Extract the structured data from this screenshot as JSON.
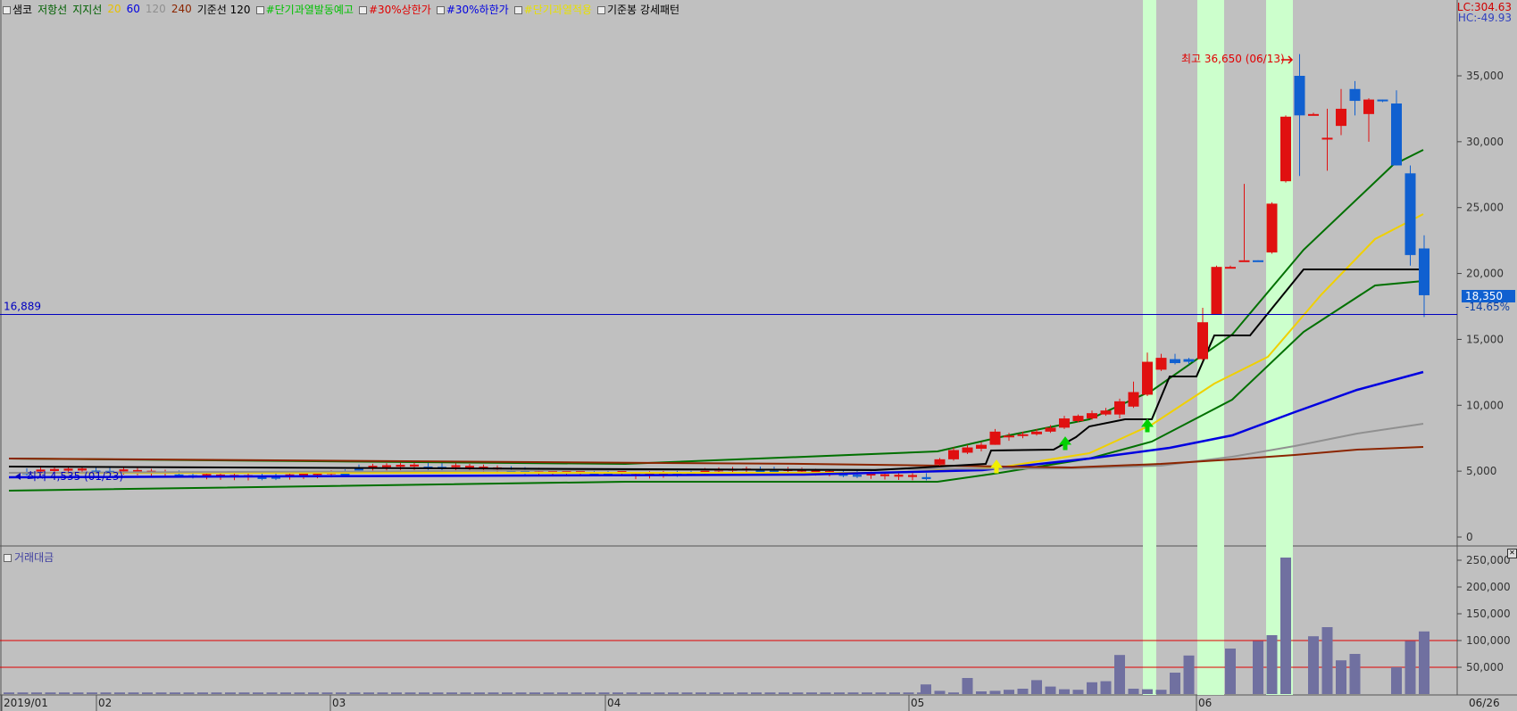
{
  "header": {
    "items": [
      {
        "label": "샘코",
        "color": "#000000",
        "box": true
      },
      {
        "label": "저항선",
        "color": "#006000",
        "box": false
      },
      {
        "label": "지지선",
        "color": "#006000",
        "box": false
      },
      {
        "label": "20",
        "color": "#e8c000",
        "box": false
      },
      {
        "label": "60",
        "color": "#0000e0",
        "box": false
      },
      {
        "label": "120",
        "color": "#909090",
        "box": false
      },
      {
        "label": "240",
        "color": "#8b2500",
        "box": false
      },
      {
        "label": "기준선 120",
        "color": "#000000",
        "box": false
      },
      {
        "label": "#단기과열발동예고",
        "color": "#00c000",
        "box": true
      },
      {
        "label": "#30%상한가",
        "color": "#e00000",
        "box": true
      },
      {
        "label": "#30%하한가",
        "color": "#0000e0",
        "box": true
      },
      {
        "label": "#단기과열적용",
        "color": "#e8e000",
        "box": true
      },
      {
        "label": "기준봉 강세패턴",
        "color": "#000000",
        "box": true
      }
    ],
    "lc_label": "LC:304.63",
    "hc_label": "HC:-49.93"
  },
  "volume_panel": {
    "title": "거래대금"
  },
  "colors": {
    "up": "#e01010",
    "down": "#1060d0",
    "highlight": "#ccffcc",
    "background": "#c0c0c0",
    "current_line": "#0000c0"
  },
  "chart_data": {
    "type": "candlestick",
    "price_axis": {
      "ticks": [
        0,
        5000,
        10000,
        15000,
        20000,
        25000,
        30000,
        35000
      ],
      "ylim": [
        0,
        40500
      ]
    },
    "volume_axis": {
      "ticks": [
        50000,
        100000,
        150000,
        200000,
        250000
      ],
      "ylim": [
        0,
        270000
      ],
      "reference_lines": [
        50000,
        100000
      ]
    },
    "x_labels": [
      "2019/01",
      "02",
      "03",
      "04",
      "05",
      "06",
      "06/26"
    ],
    "current_price_line": {
      "value": 16889,
      "label": "16,889"
    },
    "last_price": {
      "label": "18,350",
      "change": "-14.65%"
    },
    "annotations": [
      {
        "text": "최고 36,650 (06/13)",
        "value": 36650
      },
      {
        "text": "최저 4,535 (01/23)",
        "value": 4535
      }
    ],
    "highlight_days": [
      -3,
      [
        -2,
        -1
      ],
      [
        1,
        2
      ]
    ],
    "candles_recent": [
      {
        "o": 5500,
        "h": 6000,
        "l": 5400,
        "c": 5900
      },
      {
        "o": 5900,
        "h": 6800,
        "l": 5800,
        "c": 6600
      },
      {
        "o": 6400,
        "h": 7000,
        "l": 6300,
        "c": 6800
      },
      {
        "o": 6700,
        "h": 7200,
        "l": 6500,
        "c": 7000
      },
      {
        "o": 7000,
        "h": 8200,
        "l": 7000,
        "c": 8000
      },
      {
        "o": 7600,
        "h": 7900,
        "l": 7300,
        "c": 7700
      },
      {
        "o": 7700,
        "h": 8000,
        "l": 7500,
        "c": 7800
      },
      {
        "o": 7800,
        "h": 8200,
        "l": 7700,
        "c": 8000
      },
      {
        "o": 8000,
        "h": 8500,
        "l": 7900,
        "c": 8300
      },
      {
        "o": 8300,
        "h": 9200,
        "l": 8200,
        "c": 9000
      },
      {
        "o": 8800,
        "h": 9300,
        "l": 8700,
        "c": 9200
      },
      {
        "o": 9000,
        "h": 9600,
        "l": 8900,
        "c": 9400
      },
      {
        "o": 9300,
        "h": 9800,
        "l": 9200,
        "c": 9600
      },
      {
        "o": 9300,
        "h": 10500,
        "l": 9000,
        "c": 10300
      },
      {
        "o": 9900,
        "h": 11800,
        "l": 9800,
        "c": 11000
      },
      {
        "o": 10800,
        "h": 14000,
        "l": 10700,
        "c": 13300
      },
      {
        "o": 12700,
        "h": 13900,
        "l": 12600,
        "c": 13600
      },
      {
        "o": 13500,
        "h": 13900,
        "l": 13100,
        "c": 13200
      },
      {
        "o": 13500,
        "h": 13600,
        "l": 13100,
        "c": 13300
      },
      {
        "o": 13500,
        "h": 17400,
        "l": 13400,
        "c": 16300
      },
      {
        "o": 16900,
        "h": 20600,
        "l": 16900,
        "c": 20500
      },
      {
        "o": 20500,
        "h": 20600,
        "l": 20400,
        "c": 20500
      },
      {
        "o": 21000,
        "h": 26800,
        "l": 21000,
        "c": 21000
      },
      {
        "o": 21000,
        "h": 21000,
        "l": 20900,
        "c": 20900
      },
      {
        "o": 21600,
        "h": 25400,
        "l": 21500,
        "c": 25300
      },
      {
        "o": 27000,
        "h": 32000,
        "l": 26900,
        "c": 31900
      },
      {
        "o": 35000,
        "h": 36650,
        "l": 27400,
        "c": 32000
      },
      {
        "o": 32100,
        "h": 32200,
        "l": 32000,
        "c": 32100
      },
      {
        "o": 30200,
        "h": 32500,
        "l": 27800,
        "c": 30300
      },
      {
        "o": 31200,
        "h": 34000,
        "l": 30500,
        "c": 32500
      },
      {
        "o": 34000,
        "h": 34600,
        "l": 32000,
        "c": 33100
      },
      {
        "o": 32100,
        "h": 33300,
        "l": 30000,
        "c": 33200
      },
      {
        "o": 33200,
        "h": 33200,
        "l": 33000,
        "c": 33100
      },
      {
        "o": 32900,
        "h": 33900,
        "l": 28200,
        "c": 28200
      },
      {
        "o": 27600,
        "h": 28200,
        "l": 20600,
        "c": 21400
      },
      {
        "o": 21900,
        "h": 22900,
        "l": 16700,
        "c": 18350
      }
    ],
    "volume_recent": [
      18000,
      6000,
      3000,
      30000,
      5000,
      6000,
      8000,
      10000,
      26000,
      14000,
      9000,
      8000,
      22000,
      24000,
      73000,
      10000,
      9000,
      8000,
      40000,
      72000,
      0,
      0,
      85000,
      0,
      99000,
      110000,
      255000,
      0,
      108000,
      125000,
      63000,
      75000,
      0,
      0,
      50000,
      99000,
      117000
    ]
  }
}
